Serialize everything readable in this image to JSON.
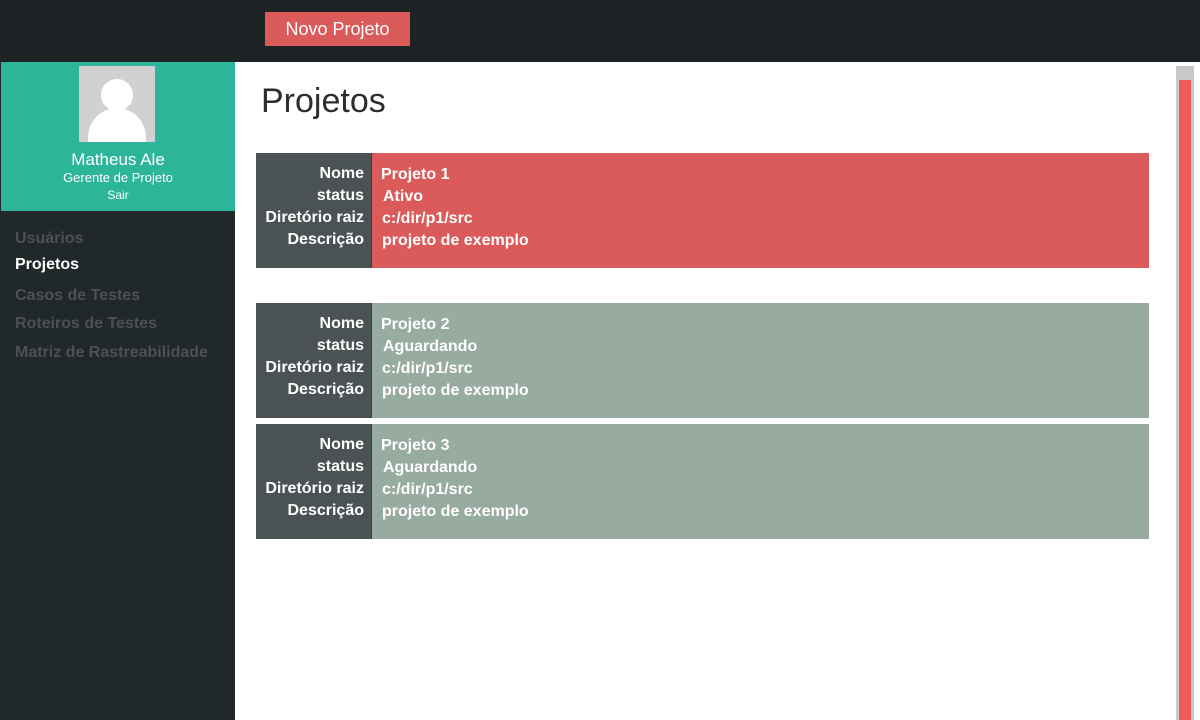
{
  "toolbar": {
    "new_project_label": "Novo Projeto"
  },
  "profile": {
    "name": "Matheus Ale",
    "role": "Gerente de Projeto",
    "logout_label": "Sair"
  },
  "nav": {
    "items": [
      {
        "label": "Usuários",
        "active": false
      },
      {
        "label": "Projetos",
        "active": true
      },
      {
        "label": "Casos de Testes",
        "active": false
      },
      {
        "label": "Roteiros de Testes",
        "active": false
      },
      {
        "label": "Matriz de Rastreabilidade",
        "active": false
      }
    ]
  },
  "page": {
    "title": "Projetos"
  },
  "labels": {
    "name": "Nome",
    "status": "status",
    "root_dir": "Diretório raiz",
    "description": "Descrição"
  },
  "projects": [
    {
      "name": "Projeto 1",
      "status": "Ativo",
      "root_dir": "c:/dir/p1/src",
      "description": "projeto de exemplo"
    },
    {
      "name": "Projeto 2",
      "status": "Aguardando",
      "root_dir": "c:/dir/p1/src",
      "description": "projeto de exemplo"
    },
    {
      "name": "Projeto 3",
      "status": "Aguardando",
      "root_dir": "c:/dir/p1/src",
      "description": "projeto de exemplo"
    }
  ],
  "colors": {
    "topbar": "#1e2326",
    "sidebar": "#212829",
    "profile": "#2db59a",
    "accent": "#db5a5a",
    "active_card": "#db5a5a",
    "waiting_card": "#98aba1",
    "label_panel": "#4b5254",
    "nav_inactive": "#4b5154",
    "scrollbar_thumb": "#f05a5a"
  }
}
